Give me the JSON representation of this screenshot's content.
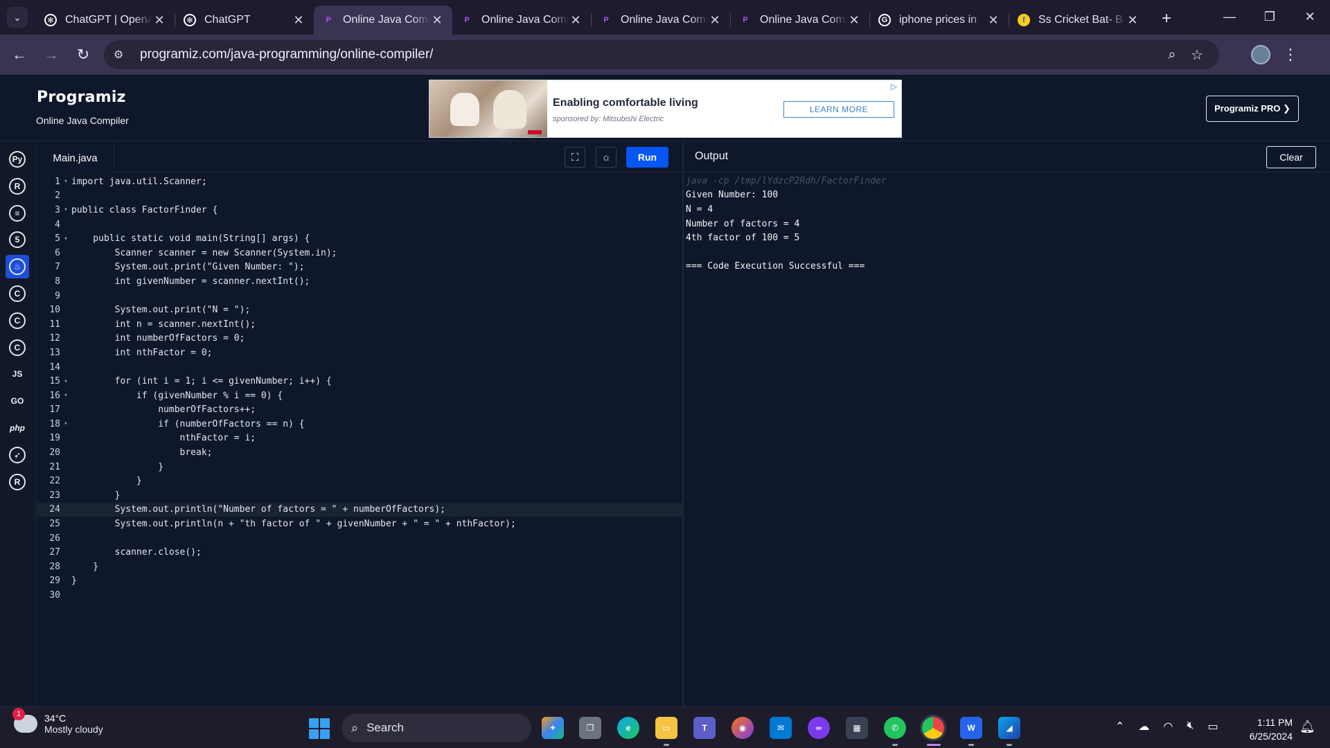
{
  "browser": {
    "tabs": [
      {
        "title": "ChatGPT | OpenAI",
        "favicon": "openai-icon"
      },
      {
        "title": "ChatGPT",
        "favicon": "openai-icon"
      },
      {
        "title": "Online Java Compiler",
        "favicon": "programiz-icon",
        "active": true
      },
      {
        "title": "Online Java Compiler",
        "favicon": "programiz-icon"
      },
      {
        "title": "Online Java Compiler",
        "favicon": "programiz-icon"
      },
      {
        "title": "Online Java Compiler",
        "favicon": "programiz-icon"
      },
      {
        "title": "iphone prices in",
        "favicon": "google-icon"
      },
      {
        "title": "Ss Cricket Bat- B",
        "favicon": "flipkart-icon"
      }
    ],
    "url": "programiz.com/java-programming/online-compiler/"
  },
  "site": {
    "logo": "Programiz",
    "subtitle": "Online Java Compiler",
    "pro_button": "Programiz PRO ❯"
  },
  "ad": {
    "title": "Enabling comfortable living",
    "sponsor": "sponsored by: Mitsubishi Electric",
    "cta": "LEARN MORE"
  },
  "editor": {
    "file_tab": "Main.java",
    "run_label": "Run",
    "highlighted_line": 24,
    "lines": [
      {
        "n": "1",
        "fold": "▾",
        "code": "import java.util.Scanner;"
      },
      {
        "n": "2",
        "fold": "",
        "code": ""
      },
      {
        "n": "3",
        "fold": "▾",
        "code": "public class FactorFinder {"
      },
      {
        "n": "4",
        "fold": "",
        "code": ""
      },
      {
        "n": "5",
        "fold": "▾",
        "code": "    public static void main(String[] args) {"
      },
      {
        "n": "6",
        "fold": "",
        "code": "        Scanner scanner = new Scanner(System.in);"
      },
      {
        "n": "7",
        "fold": "",
        "code": "        System.out.print(\"Given Number: \");"
      },
      {
        "n": "8",
        "fold": "",
        "code": "        int givenNumber = scanner.nextInt();"
      },
      {
        "n": "9",
        "fold": "",
        "code": ""
      },
      {
        "n": "10",
        "fold": "",
        "code": "        System.out.print(\"N = \");"
      },
      {
        "n": "11",
        "fold": "",
        "code": "        int n = scanner.nextInt();"
      },
      {
        "n": "12",
        "fold": "",
        "code": "        int numberOfFactors = 0;"
      },
      {
        "n": "13",
        "fold": "",
        "code": "        int nthFactor = 0;"
      },
      {
        "n": "14",
        "fold": "",
        "code": ""
      },
      {
        "n": "15",
        "fold": "▾",
        "code": "        for (int i = 1; i <= givenNumber; i++) {"
      },
      {
        "n": "16",
        "fold": "▾",
        "code": "            if (givenNumber % i == 0) {"
      },
      {
        "n": "17",
        "fold": "",
        "code": "                numberOfFactors++;"
      },
      {
        "n": "18",
        "fold": "▾",
        "code": "                if (numberOfFactors == n) {"
      },
      {
        "n": "19",
        "fold": "",
        "code": "                    nthFactor = i;"
      },
      {
        "n": "20",
        "fold": "",
        "code": "                    break;"
      },
      {
        "n": "21",
        "fold": "",
        "code": "                }"
      },
      {
        "n": "22",
        "fold": "",
        "code": "            }"
      },
      {
        "n": "23",
        "fold": "",
        "code": "        }"
      },
      {
        "n": "24",
        "fold": "",
        "code": "        System.out.println(\"Number of factors = \" + numberOfFactors);"
      },
      {
        "n": "25",
        "fold": "",
        "code": "        System.out.println(n + \"th factor of \" + givenNumber + \" = \" + nthFactor);"
      },
      {
        "n": "26",
        "fold": "",
        "code": ""
      },
      {
        "n": "27",
        "fold": "",
        "code": "        scanner.close();"
      },
      {
        "n": "28",
        "fold": "",
        "code": "    }"
      },
      {
        "n": "29",
        "fold": "",
        "code": "}"
      },
      {
        "n": "30",
        "fold": "",
        "code": ""
      }
    ]
  },
  "output": {
    "title": "Output",
    "clear_label": "Clear",
    "lines": [
      {
        "text": "java -cp /tmp/lYdzcP2Rdh/FactorFinder",
        "kind": "cmd"
      },
      {
        "text": "Given Number: 100",
        "kind": "out"
      },
      {
        "text": "N = 4",
        "kind": "out"
      },
      {
        "text": "Number of factors = 4",
        "kind": "out"
      },
      {
        "text": "4th factor of 100 = 5",
        "kind": "out"
      },
      {
        "text": "",
        "kind": "out"
      },
      {
        "text": "=== Code Execution Successful ===",
        "kind": "out"
      }
    ]
  },
  "rail": [
    {
      "name": "python-icon",
      "label": "Py"
    },
    {
      "name": "r-icon",
      "label": "R"
    },
    {
      "name": "sql-icon",
      "label": "≡"
    },
    {
      "name": "html-icon",
      "label": "5"
    },
    {
      "name": "java-icon",
      "label": "♨",
      "active": true
    },
    {
      "name": "c-icon",
      "label": "C"
    },
    {
      "name": "cpp-icon",
      "label": "C"
    },
    {
      "name": "csharp-icon",
      "label": "C"
    },
    {
      "name": "javascript-icon",
      "label": "JS"
    },
    {
      "name": "go-icon",
      "label": "GO"
    },
    {
      "name": "php-icon",
      "label": "php"
    },
    {
      "name": "swift-icon",
      "label": "➶"
    },
    {
      "name": "rust-icon",
      "label": "R"
    }
  ],
  "taskbar": {
    "weather_badge": "1",
    "temperature": "34°C",
    "condition": "Mostly cloudy",
    "search_placeholder": "Search",
    "time": "1:11 PM",
    "date": "6/25/2024"
  },
  "colors": {
    "accent": "#0556f3",
    "editor_bg": "#0f172a",
    "chrome_bg": "#3a3452"
  }
}
